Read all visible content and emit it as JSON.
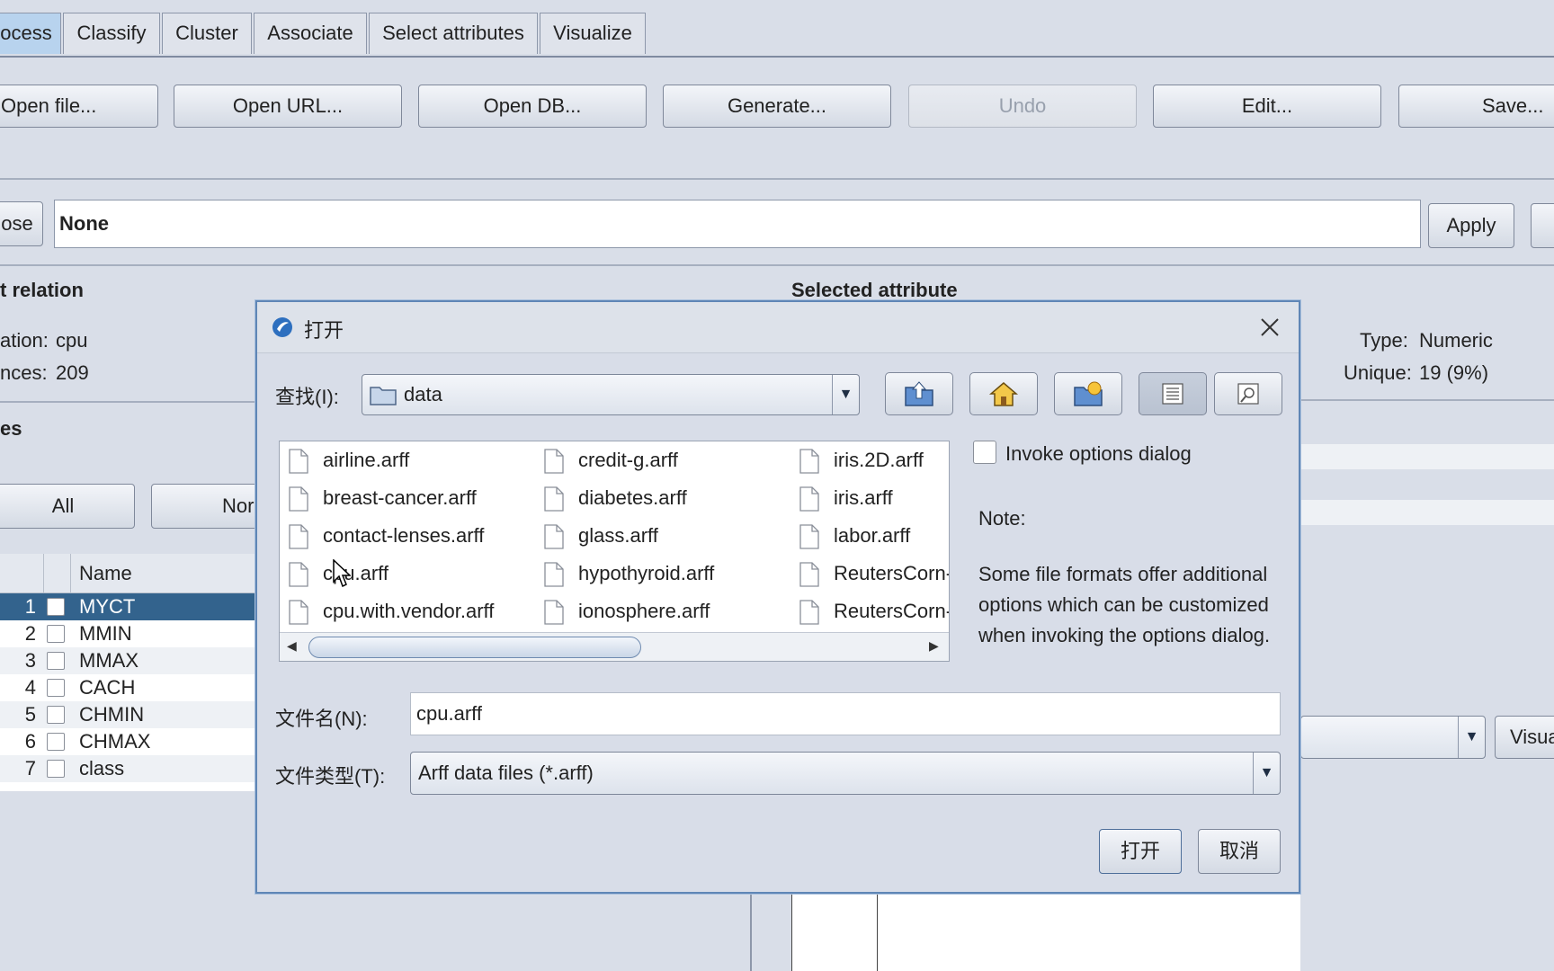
{
  "tabs": [
    "ocess",
    "Classify",
    "Cluster",
    "Associate",
    "Select attributes",
    "Visualize"
  ],
  "toolbar": {
    "open_file": "Open file...",
    "open_url": "Open URL...",
    "open_db": "Open DB...",
    "generate": "Generate...",
    "undo": "Undo",
    "edit": "Edit...",
    "save": "Save..."
  },
  "filter": {
    "choose_label": "ose",
    "value": "None",
    "apply": "Apply"
  },
  "current_relation": {
    "title": "t relation",
    "relation_label": "ation:",
    "relation_value": "cpu",
    "instances_label": "nces:",
    "instances_value": "209"
  },
  "selected_attribute": {
    "title": "Selected attribute",
    "type_label": "Type:",
    "type_value": "Numeric",
    "unique_label": "Unique:",
    "unique_value": "19 (9%)",
    "visualize_button": "Visua"
  },
  "attributes": {
    "title": "es",
    "all_button": "All",
    "none_button": "Nor",
    "name_header": "Name",
    "rows": [
      {
        "num": "1",
        "name": "MYCT"
      },
      {
        "num": "2",
        "name": "MMIN"
      },
      {
        "num": "3",
        "name": "MMAX"
      },
      {
        "num": "4",
        "name": "CACH"
      },
      {
        "num": "5",
        "name": "CHMIN"
      },
      {
        "num": "6",
        "name": "CHMAX"
      },
      {
        "num": "7",
        "name": "class"
      }
    ]
  },
  "dialog": {
    "title": "打开",
    "look_in_label": "查找(I):",
    "look_in_value": "data",
    "files": [
      "airline.arff",
      "breast-cancer.arff",
      "contact-lenses.arff",
      "cpu.arff",
      "cpu.with.vendor.arff",
      "credit-g.arff",
      "diabetes.arff",
      "glass.arff",
      "hypothyroid.arff",
      "ionosphere.arff",
      "iris.2D.arff",
      "iris.arff",
      "labor.arff",
      "ReutersCorn-te",
      "ReutersCorn-tr"
    ],
    "invoke_options": "Invoke options dialog",
    "note_label": "Note:",
    "note_lines": [
      "Some file formats offer additional",
      "options which can be customized",
      "when invoking the options dialog."
    ],
    "filename_label": "文件名(N):",
    "filename_value": "cpu.arff",
    "filetype_label": "文件类型(T):",
    "filetype_value": "Arff data files (*.arff)",
    "open_button": "打开",
    "cancel_button": "取消"
  },
  "colors": {
    "accent": "#33638d",
    "tab_active": "#b8d3ee",
    "dialog_border": "#5f86b6"
  }
}
